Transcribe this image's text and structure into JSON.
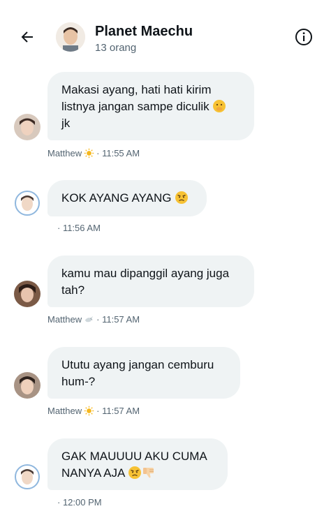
{
  "header": {
    "title": "Planet Maechu",
    "subtitle": "13 orang",
    "back_icon": "arrow-left-icon",
    "info_icon": "info-icon"
  },
  "messages": [
    {
      "text": "Makasi ayang, hati hati kirim listnya jangan sampe diculik",
      "text_tail": "jk",
      "emoji": "hand-over-mouth-emoji",
      "sender": "Matthew",
      "sender_emoji": "sun-emoji",
      "time": "· 11:55 AM"
    },
    {
      "text": "KOK AYANG AYANG",
      "emoji": "angry-face-emoji",
      "sender": "",
      "time": "· 11:56 AM"
    },
    {
      "text": "kamu mau dipanggil ayang juga tah?",
      "sender": "Matthew",
      "sender_emoji": "dove-emoji",
      "time": "· 11:57 AM"
    },
    {
      "text": "Ututu ayang jangan cemburu hum-?",
      "sender": "Matthew",
      "sender_emoji": "sun-emoji",
      "time": "· 11:57 AM"
    },
    {
      "text_line1": "GAK MAUUUU AKU CUMA",
      "text_line2": "NANYA AJA",
      "emojis": [
        "angry-face-emoji",
        "thumbs-down-emoji"
      ],
      "sender": "",
      "time": "· 12:00 PM"
    }
  ],
  "colors": {
    "bubble": "#eff3f4",
    "meta_text": "#536471",
    "text": "#0f1419"
  }
}
